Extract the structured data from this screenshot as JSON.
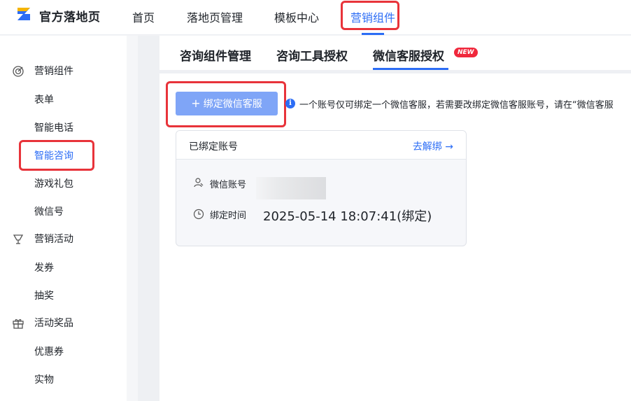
{
  "brand": {
    "name": "官方落地页",
    "logo_icon": "brand-logo-icon"
  },
  "nav": {
    "items": [
      {
        "label": "首页",
        "active": false
      },
      {
        "label": "落地页管理",
        "active": false
      },
      {
        "label": "模板中心",
        "active": false
      },
      {
        "label": "营销组件",
        "active": true
      }
    ]
  },
  "sidebar": {
    "groups": [
      {
        "label": "营销组件",
        "icon": "target-icon",
        "items": [
          "表单",
          "智能电话",
          "智能咨询",
          "游戏礼包",
          "微信号"
        ]
      },
      {
        "label": "营销活动",
        "icon": "trophy-icon",
        "items": [
          "发券",
          "抽奖"
        ]
      },
      {
        "label": "活动奖品",
        "icon": "gift-icon",
        "items": [
          "优惠券",
          "实物"
        ]
      }
    ],
    "active_item": "智能咨询"
  },
  "subtabs": {
    "items": [
      "咨询组件管理",
      "咨询工具授权",
      "微信客服授权"
    ],
    "active": "微信客服授权",
    "badge": "NEW"
  },
  "actions": {
    "bind_button": "绑定微信客服",
    "plus": "+"
  },
  "notice": {
    "icon_glyph": "i",
    "text": "一个账号仅可绑定一个微信客服，若需要改绑定微信客服账号，请在“微信客服"
  },
  "card": {
    "title": "已绑定账号",
    "unbind_link": "去解绑 →",
    "account_label": "微信账号",
    "time_label": "绑定时间",
    "time_value": "2025-05-14 18:07:41(绑定)"
  },
  "colors": {
    "accent": "#2c6df5",
    "highlight": "#e8333a",
    "badge": "#f0283c",
    "button": "#7fa5f7"
  }
}
